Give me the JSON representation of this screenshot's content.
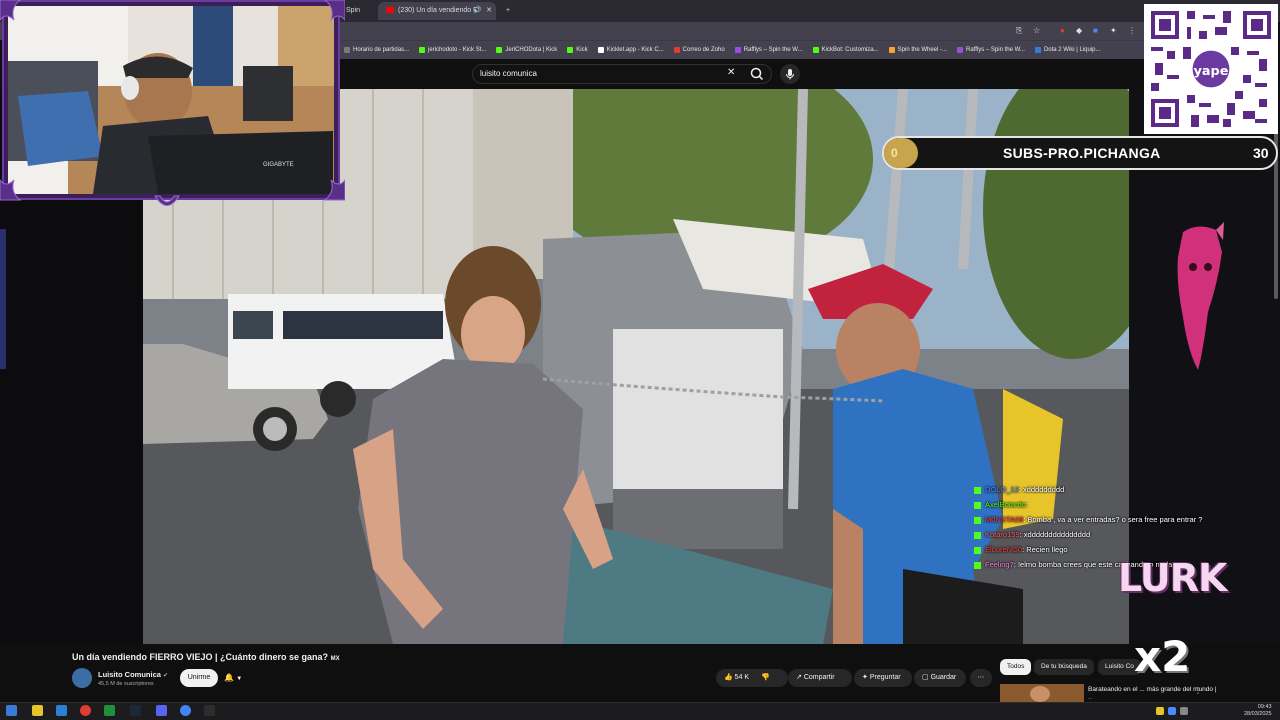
{
  "browser": {
    "tabs": [
      {
        "label": "Spin"
      },
      {
        "label": "(230) Un día vendiendo FI",
        "active": true
      }
    ],
    "new_tab_label": "+",
    "bookmarks": [
      {
        "label": "Horario de partidas...",
        "color": "#7a7a7a"
      },
      {
        "label": "jerichodoto - Kick St...",
        "color": "#53fc18"
      },
      {
        "label": "JeriCHODota | Kick",
        "color": "#53fc18"
      },
      {
        "label": "Kick",
        "color": "#53fc18"
      },
      {
        "label": "Kicklet.app - Kick C...",
        "color": "#ffffff"
      },
      {
        "label": "Correo de Zoho",
        "color": "#e03c31"
      },
      {
        "label": "Rafflys – Spin the W...",
        "color": "#9b4de0"
      },
      {
        "label": "KickBot: Customiza...",
        "color": "#53fc18"
      },
      {
        "label": "Spin the Wheel -...",
        "color": "#f5a623"
      },
      {
        "label": "Rafflys – Spin the W...",
        "color": "#9b4de0"
      },
      {
        "label": "Dota 2 Wiki | Liquip...",
        "color": "#3a7bd5"
      }
    ]
  },
  "youtube": {
    "search_query": "luisito comunica",
    "video_title": "Un día vendiendo FIERRO VIEJO | ¿Cuánto dinero se gana?",
    "video_title_flag": "MX",
    "channel_name": "Luisito Comunica",
    "channel_verified": "✔",
    "channel_subs": "45,5 M de suscriptores",
    "join_label": "Unirme",
    "like_count": "54 K",
    "share_label": "Compartir",
    "ask_label": "Preguntar",
    "save_label": "Guardar",
    "more_label": "⋯",
    "chips": [
      "Todos",
      "De tu búsqueda",
      "Luisito Co"
    ],
    "recommended": {
      "title": "Barateando en el ... más grande del mundo |",
      "channel": "..."
    }
  },
  "stream_overlay": {
    "goal_current": "0",
    "goal_title": "SUBS-PRO.PICHANGA",
    "goal_target": "30",
    "lurk_text": "LURK",
    "multiplier": "x2",
    "chat": [
      {
        "user": "DOLO_12",
        "user_color": "#4a8cff",
        "msg": ": xddddddddd"
      },
      {
        "user": "AxelBotardo",
        "user_color": "#53fc18",
        "msg": ":"
      },
      {
        "user": "M0NSTA08",
        "user_color": "#ff3b3b",
        "msg": ": Bomba , va a ver entradas? o sera free para entrar ?"
      },
      {
        "user": "Kotaro159",
        "user_color": "#ff5a5a",
        "msg": ": xddddddddddddddd"
      },
      {
        "user": "ElLoreNG0",
        "user_color": "#ff3b3b",
        "msg": ": Recien llego"
      },
      {
        "user": "Feeling7",
        "user_color": "#ff7ad9",
        "msg": ": !elmo bomba crees que este cachando o nada"
      }
    ]
  },
  "webcam": {
    "monitor_brand": "GIGABYTE"
  },
  "qr": {
    "brand": "yape"
  },
  "taskbar": {
    "time": "09:43",
    "date": "28/03/2025"
  },
  "colors": {
    "overlay_frame": "#3a1f59",
    "youtube_bg": "#0f0f0f",
    "kick_green": "#53fc18"
  }
}
